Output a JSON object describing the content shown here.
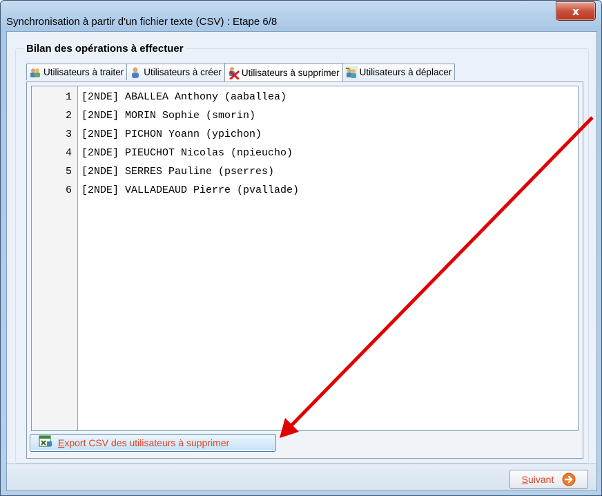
{
  "window": {
    "title": "Synchronisation à partir d'un fichier texte (CSV) : Etape 6/8",
    "close_label": "x"
  },
  "group": {
    "title": "Bilan des opérations à effectuer"
  },
  "tabs": [
    {
      "label": "Utilisateurs à traiter",
      "icon": "users-group-icon",
      "active": false
    },
    {
      "label": "Utilisateurs à créer",
      "icon": "user-icon",
      "active": false
    },
    {
      "label": "Utilisateurs à supprimer",
      "icon": "user-delete-icon",
      "active": true
    },
    {
      "label": "Utilisateurs à déplacer",
      "icon": "users-move-icon",
      "active": false
    }
  ],
  "list": {
    "rows": [
      {
        "num": "1",
        "text": "[2NDE] ABALLEA Anthony (aaballea)"
      },
      {
        "num": "2",
        "text": "[2NDE] MORIN Sophie (smorin)"
      },
      {
        "num": "3",
        "text": "[2NDE] PICHON Yoann (ypichon)"
      },
      {
        "num": "4",
        "text": "[2NDE] PIEUCHOT Nicolas (npieucho)"
      },
      {
        "num": "5",
        "text": "[2NDE] SERRES Pauline (pserres)"
      },
      {
        "num": "6",
        "text": "[2NDE] VALLADEAUD Pierre (pvallade)"
      }
    ]
  },
  "export": {
    "label_mnemonic": "E",
    "label_rest": "xport CSV des utilisateurs à supprimer",
    "icon": "excel-export-icon"
  },
  "footer": {
    "next_mnemonic": "S",
    "next_rest": "uivant",
    "next_icon": "arrow-right-circle-icon"
  },
  "colors": {
    "accent_text": "#e0401f",
    "annotation_arrow": "#e00000"
  }
}
